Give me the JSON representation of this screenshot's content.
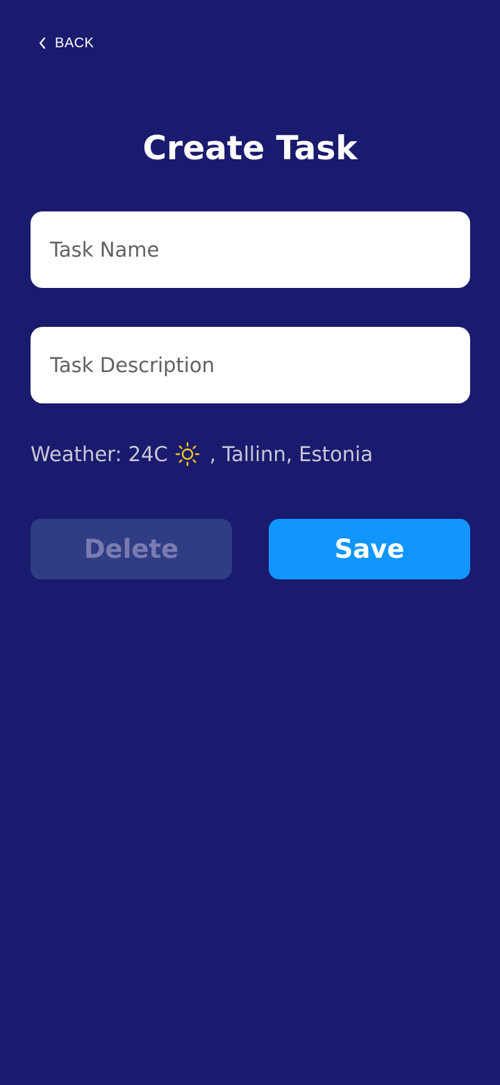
{
  "header": {
    "back_label": "BACK",
    "back_icon": "chevron-left-icon"
  },
  "page": {
    "title": "Create Task"
  },
  "form": {
    "task_name": {
      "value": "",
      "placeholder": "Task Name"
    },
    "task_description": {
      "value": "",
      "placeholder": "Task Description"
    }
  },
  "weather": {
    "prefix": "Weather: 24C",
    "icon": "sun-icon",
    "location": ", Tallinn, Estonia"
  },
  "actions": {
    "delete_label": "Delete",
    "save_label": "Save"
  },
  "colors": {
    "background": "#1a1a6e",
    "save_button": "#1196ff",
    "delete_button": "#2e3d84",
    "sun": "#f5c518"
  }
}
